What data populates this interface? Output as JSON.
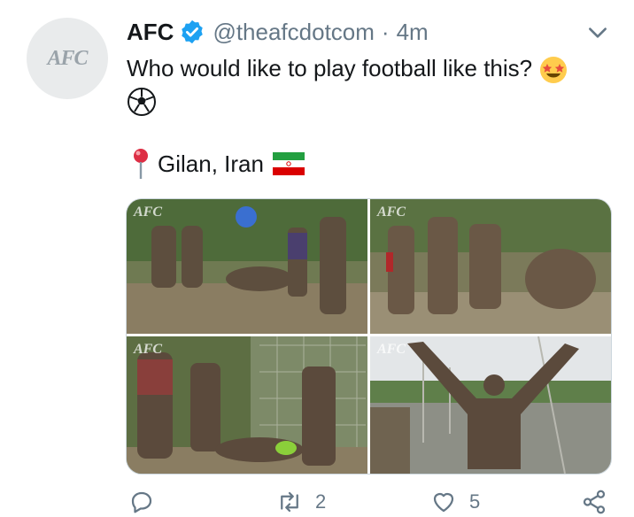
{
  "tweet": {
    "author_name": "AFC",
    "author_handle": "@theafcdotcom",
    "separator": "·",
    "timestamp": "4m",
    "text": "Who would like to play football like this?",
    "avatar_logo": "AFC",
    "location": "Gilan, Iran",
    "emojis": [
      "star-struck-emoji",
      "soccer-ball-emoji"
    ],
    "icons": {
      "verified": "verified-badge-icon",
      "menu": "chevron-down-icon",
      "pin": "round-pushpin-icon",
      "flag": "iran-flag-icon"
    },
    "media": [
      {
        "watermark": "AFC"
      },
      {
        "watermark": "AFC"
      },
      {
        "watermark": "AFC"
      },
      {
        "watermark": "AFC"
      }
    ],
    "actions": {
      "reply_count": "",
      "retweet_count": "2",
      "like_count": "5"
    }
  },
  "colors": {
    "verified_blue": "#1da1f2",
    "secondary_text": "#657786",
    "primary_text": "#14171a",
    "border": "#ccd6dd"
  }
}
